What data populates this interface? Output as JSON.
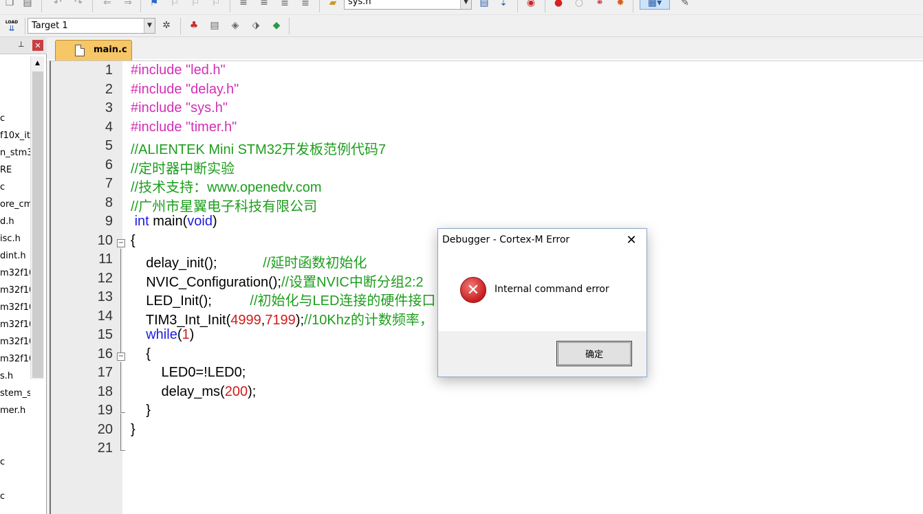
{
  "toolbar": {
    "file_combo_value": "sys.h",
    "target_value": "Target 1",
    "load_label": "LOAD"
  },
  "project_tree": {
    "items": [
      "c",
      "f10x_it",
      "n_stm3",
      "RE",
      "c",
      "ore_cm",
      "d.h",
      "isc.h",
      "dint.h",
      "m32f10",
      "m32f10",
      "m32f10",
      "m32f10",
      "m32f10",
      "m32f10",
      "s.h",
      "stem_s",
      "mer.h",
      "c",
      "c"
    ]
  },
  "editor": {
    "tab_label": "main.c",
    "lines": [
      {
        "n": "1",
        "parts": [
          {
            "t": "pp",
            "v": "#include \"led.h\""
          }
        ]
      },
      {
        "n": "2",
        "parts": [
          {
            "t": "pp",
            "v": "#include \"delay.h\""
          }
        ]
      },
      {
        "n": "3",
        "parts": [
          {
            "t": "pp",
            "v": "#include \"sys.h\""
          }
        ]
      },
      {
        "n": "4",
        "parts": [
          {
            "t": "pp",
            "v": "#include \"timer.h\""
          }
        ]
      },
      {
        "n": "5",
        "parts": [
          {
            "t": "cm",
            "v": "//ALIENTEK Mini STM32开发板范例代码7"
          }
        ]
      },
      {
        "n": "6",
        "parts": [
          {
            "t": "cm",
            "v": "//定时器中断实验"
          }
        ]
      },
      {
        "n": "7",
        "parts": [
          {
            "t": "cm",
            "v": "//技术支持：www.openedv.com"
          }
        ]
      },
      {
        "n": "8",
        "parts": [
          {
            "t": "cm",
            "v": "//广州市星翼电子科技有限公司"
          }
        ]
      },
      {
        "n": "9",
        "parts": [
          {
            "t": "tx",
            "v": " "
          },
          {
            "t": "kw",
            "v": "int"
          },
          {
            "t": "tx",
            "v": " main("
          },
          {
            "t": "kw",
            "v": "void"
          },
          {
            "t": "tx",
            "v": ")"
          }
        ]
      },
      {
        "n": "10",
        "parts": [
          {
            "t": "tx",
            "v": "{"
          }
        ]
      },
      {
        "n": "11",
        "parts": [
          {
            "t": "tx",
            "v": "    delay_init();            "
          },
          {
            "t": "cm",
            "v": "//延时函数初始化"
          }
        ]
      },
      {
        "n": "12",
        "parts": [
          {
            "t": "tx",
            "v": "    NVIC_Configuration();"
          },
          {
            "t": "cm",
            "v": "//设置NVIC中断分组2:2"
          }
        ]
      },
      {
        "n": "13",
        "parts": [
          {
            "t": "tx",
            "v": "    LED_Init();          "
          },
          {
            "t": "cm",
            "v": "//初始化与LED连接的硬件接口"
          }
        ]
      },
      {
        "n": "14",
        "parts": [
          {
            "t": "tx",
            "v": "    TIM3_Int_Init("
          },
          {
            "t": "num",
            "v": "4999"
          },
          {
            "t": "tx",
            "v": ","
          },
          {
            "t": "num",
            "v": "7199"
          },
          {
            "t": "tx",
            "v": ");"
          },
          {
            "t": "cm",
            "v": "//10Khz的计数频率，"
          }
        ]
      },
      {
        "n": "15",
        "parts": [
          {
            "t": "tx",
            "v": "    "
          },
          {
            "t": "kw",
            "v": "while"
          },
          {
            "t": "tx",
            "v": "("
          },
          {
            "t": "num",
            "v": "1"
          },
          {
            "t": "tx",
            "v": ")"
          }
        ]
      },
      {
        "n": "16",
        "parts": [
          {
            "t": "tx",
            "v": "    {"
          }
        ]
      },
      {
        "n": "17",
        "parts": [
          {
            "t": "tx",
            "v": "        LED0=!LED0;"
          }
        ]
      },
      {
        "n": "18",
        "parts": [
          {
            "t": "tx",
            "v": "        delay_ms("
          },
          {
            "t": "num",
            "v": "200"
          },
          {
            "t": "tx",
            "v": ");"
          }
        ]
      },
      {
        "n": "19",
        "parts": [
          {
            "t": "tx",
            "v": "    }"
          }
        ]
      },
      {
        "n": "20",
        "parts": [
          {
            "t": "tx",
            "v": "}"
          }
        ]
      },
      {
        "n": "21",
        "parts": [
          {
            "t": "tx",
            "v": ""
          }
        ]
      }
    ]
  },
  "dialog": {
    "title": "Debugger - Cortex-M Error",
    "message": "Internal command error",
    "ok_label": "确定",
    "close_symbol": "✕",
    "error_icon_symbol": "✕"
  },
  "colors": {
    "preprocessor": "#d32fb4",
    "comment": "#1d9e1d",
    "keyword": "#1c1ce0",
    "number": "#d11b1b",
    "tab_active": "#f7c667"
  }
}
